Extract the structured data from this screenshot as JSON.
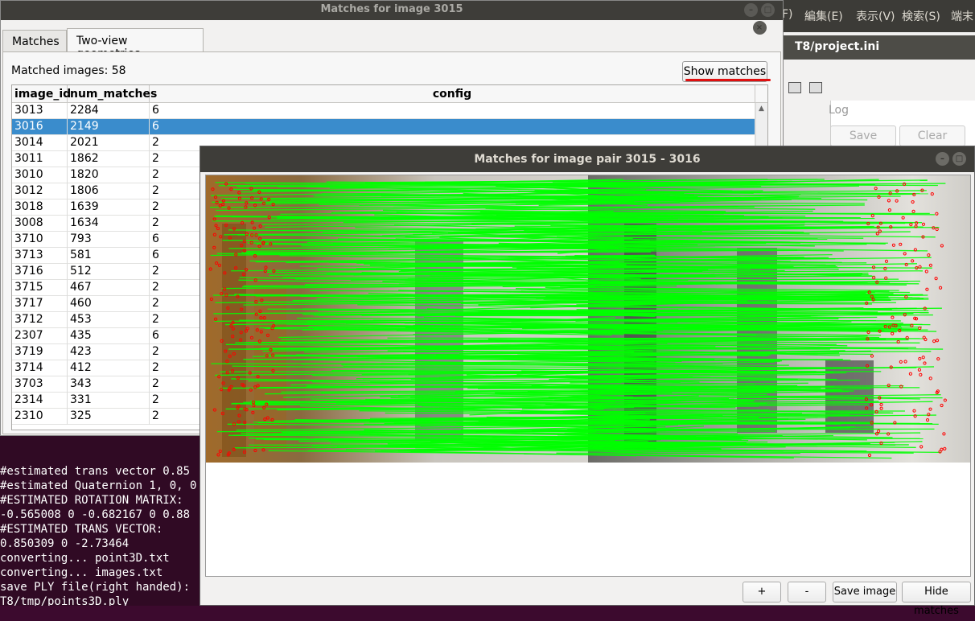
{
  "terminal": {
    "lines": [
      "#estimated trans vector 0.85",
      "#estimated Quaternion 1, 0, 0",
      "#ESTIMATED ROTATION MATRIX:",
      "-0.565008 0 -0.682167 0 0.88",
      "#ESTIMATED TRANS VECTOR:",
      "0.850309 0 -2.73464",
      "converting... point3D.txt",
      "converting... images.txt",
      "save PLY file(right handed):",
      "T8/tmp/points3D.ply"
    ]
  },
  "background_app": {
    "menu": [
      "F)",
      "編集(E)",
      "表示(V)",
      "検索(S)",
      "端末"
    ],
    "title": "T8/project.ini",
    "log_label": "Log",
    "save_label": "Save",
    "clear_label": "Clear"
  },
  "matches_window": {
    "title": "Matches for image 3015",
    "tabs": [
      "Matches",
      "Two-view geometries"
    ],
    "active_tab": "Two-view geometries",
    "matched_images": "Matched images: 58",
    "show_matches_label": "Show matches",
    "columns": [
      "image_id",
      "num_matches",
      "config"
    ],
    "rows": [
      [
        "3013",
        "2284",
        "6"
      ],
      [
        "3016",
        "2149",
        "6"
      ],
      [
        "3014",
        "2021",
        "2"
      ],
      [
        "3011",
        "1862",
        "2"
      ],
      [
        "3010",
        "1820",
        "2"
      ],
      [
        "3012",
        "1806",
        "2"
      ],
      [
        "3018",
        "1639",
        "2"
      ],
      [
        "3008",
        "1634",
        "2"
      ],
      [
        "3710",
        "793",
        "6"
      ],
      [
        "3713",
        "581",
        "6"
      ],
      [
        "3716",
        "512",
        "2"
      ],
      [
        "3715",
        "467",
        "2"
      ],
      [
        "3717",
        "460",
        "2"
      ],
      [
        "3712",
        "453",
        "2"
      ],
      [
        "2307",
        "435",
        "6"
      ],
      [
        "3719",
        "423",
        "2"
      ],
      [
        "3714",
        "412",
        "2"
      ],
      [
        "3703",
        "343",
        "2"
      ],
      [
        "2314",
        "331",
        "2"
      ],
      [
        "2310",
        "325",
        "2"
      ]
    ],
    "selected_row": 1
  },
  "pair_window": {
    "title": "Matches for image pair 3015 - 3016",
    "buttons": [
      "+",
      "-",
      "Save image",
      "Hide matches"
    ]
  },
  "colors": {
    "selection": "#3a8ccc",
    "match_lines": "#00ff00",
    "keypoints": "#ff0000",
    "title_bar": "#3e3d39",
    "close_button": "#e5633a"
  }
}
